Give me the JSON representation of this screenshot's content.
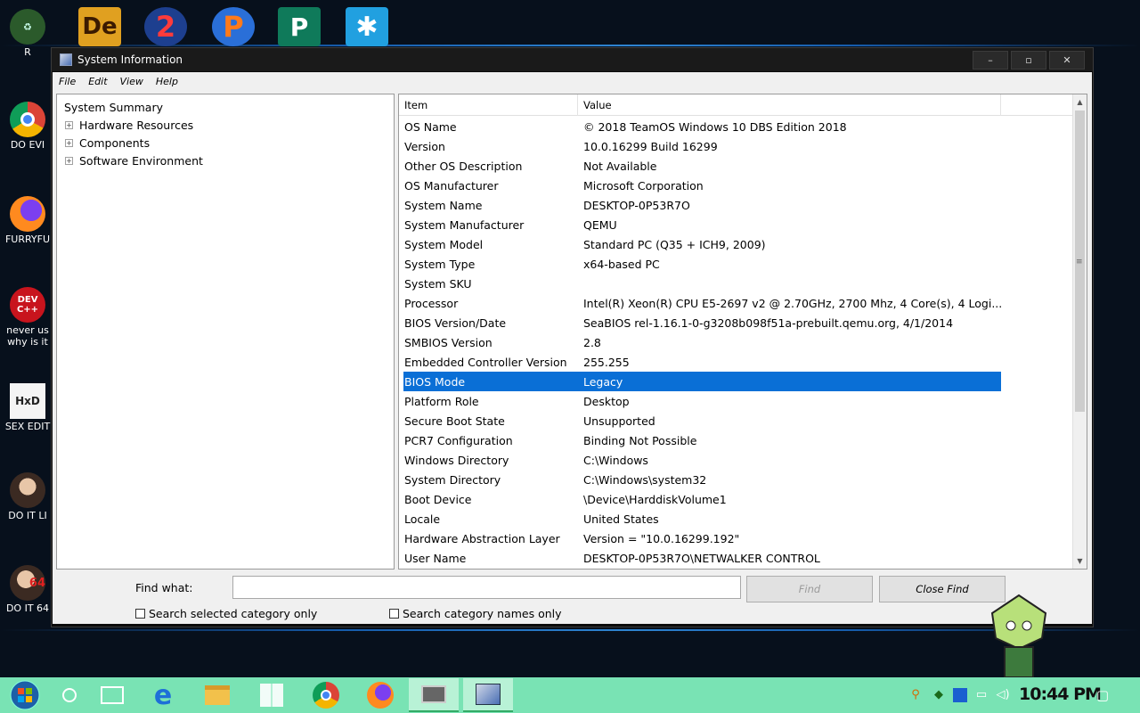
{
  "desktop": {
    "top_icons": [
      {
        "icon": "de-app-icon",
        "text": "De"
      },
      {
        "icon": "two-app-icon",
        "text": "2"
      },
      {
        "icon": "p-app-icon",
        "text": "P"
      },
      {
        "icon": "publisher-icon",
        "text": "P"
      },
      {
        "icon": "snowflake-icon",
        "text": "✱"
      }
    ],
    "left_icons": [
      {
        "icon": "recycle-bin-icon",
        "label": "R"
      },
      {
        "icon": "chrome-icon",
        "label": "DO EVI"
      },
      {
        "icon": "firefox-icon",
        "label": "FURRYFU"
      },
      {
        "icon": "devcpp-icon",
        "label": "never us\nwhy is it",
        "label1": "never us",
        "label2": "why is it",
        "glyph": "DEV C++"
      },
      {
        "icon": "hxd-icon",
        "label": "SEX EDIT",
        "glyph": "HxD"
      },
      {
        "icon": "portrait-icon",
        "label": "DO IT LI"
      },
      {
        "icon": "portrait-64-icon",
        "label": "DO IT 64",
        "glyph": "64"
      }
    ]
  },
  "window": {
    "title": "System Information",
    "controls": {
      "minimize": "–",
      "maximize": "▫",
      "close": "✕"
    },
    "menu": [
      "File",
      "Edit",
      "View",
      "Help"
    ],
    "tree": {
      "root": "System Summary",
      "children": [
        "Hardware Resources",
        "Components",
        "Software Environment"
      ],
      "expander": "+"
    },
    "list": {
      "columns": {
        "item": "Item",
        "value": "Value"
      },
      "rows": [
        {
          "item": "OS Name",
          "value": "© 2018 TeamOS Windows 10 DBS Edition 2018"
        },
        {
          "item": "Version",
          "value": "10.0.16299 Build 16299"
        },
        {
          "item": "Other OS Description",
          "value": "Not Available"
        },
        {
          "item": "OS Manufacturer",
          "value": "Microsoft Corporation"
        },
        {
          "item": "System Name",
          "value": "DESKTOP-0P53R7O"
        },
        {
          "item": "System Manufacturer",
          "value": "QEMU"
        },
        {
          "item": "System Model",
          "value": "Standard PC (Q35 + ICH9, 2009)"
        },
        {
          "item": "System Type",
          "value": "x64-based PC"
        },
        {
          "item": "System SKU",
          "value": ""
        },
        {
          "item": "Processor",
          "value": "Intel(R) Xeon(R) CPU E5-2697 v2 @ 2.70GHz, 2700 Mhz, 4 Core(s), 4 Logi..."
        },
        {
          "item": "BIOS Version/Date",
          "value": "SeaBIOS rel-1.16.1-0-g3208b098f51a-prebuilt.qemu.org, 4/1/2014"
        },
        {
          "item": "SMBIOS Version",
          "value": "2.8"
        },
        {
          "item": "Embedded Controller Version",
          "value": "255.255"
        },
        {
          "item": "BIOS Mode",
          "value": "Legacy"
        },
        {
          "item": "Platform Role",
          "value": "Desktop"
        },
        {
          "item": "Secure Boot State",
          "value": "Unsupported"
        },
        {
          "item": "PCR7 Configuration",
          "value": "Binding Not Possible"
        },
        {
          "item": "Windows Directory",
          "value": "C:\\Windows"
        },
        {
          "item": "System Directory",
          "value": "C:\\Windows\\system32"
        },
        {
          "item": "Boot Device",
          "value": "\\Device\\HarddiskVolume1"
        },
        {
          "item": "Locale",
          "value": "United States"
        },
        {
          "item": "Hardware Abstraction Layer",
          "value": "Version = \"10.0.16299.192\""
        },
        {
          "item": "User Name",
          "value": "DESKTOP-0P53R7O\\NETWALKER CONTROL"
        }
      ],
      "selected_row": "BIOS Mode"
    },
    "find": {
      "label": "Find what:",
      "value": "",
      "find_button": "Find",
      "close_find_button": "Close Find",
      "search_selected_label": "Search selected category only",
      "search_names_label": "Search category names only"
    }
  },
  "taskbar": {
    "clock": "10:44 PM",
    "buttons": [
      "start-icon",
      "cortana-icon",
      "task-view-icon",
      "edge-icon",
      "file-explorer-icon",
      "store-icon",
      "chrome-icon",
      "firefox-icon",
      "app-window-icon",
      "system-information-icon"
    ],
    "active_button": "system-information-icon",
    "tray": [
      "search-tray-icon",
      "network-status-icon",
      "antivirus-icon",
      "network-icon",
      "volume-icon",
      "notifications-icon"
    ],
    "colors": {
      "taskbar": "#79e3b4",
      "selection": "#0a6fd6"
    }
  }
}
